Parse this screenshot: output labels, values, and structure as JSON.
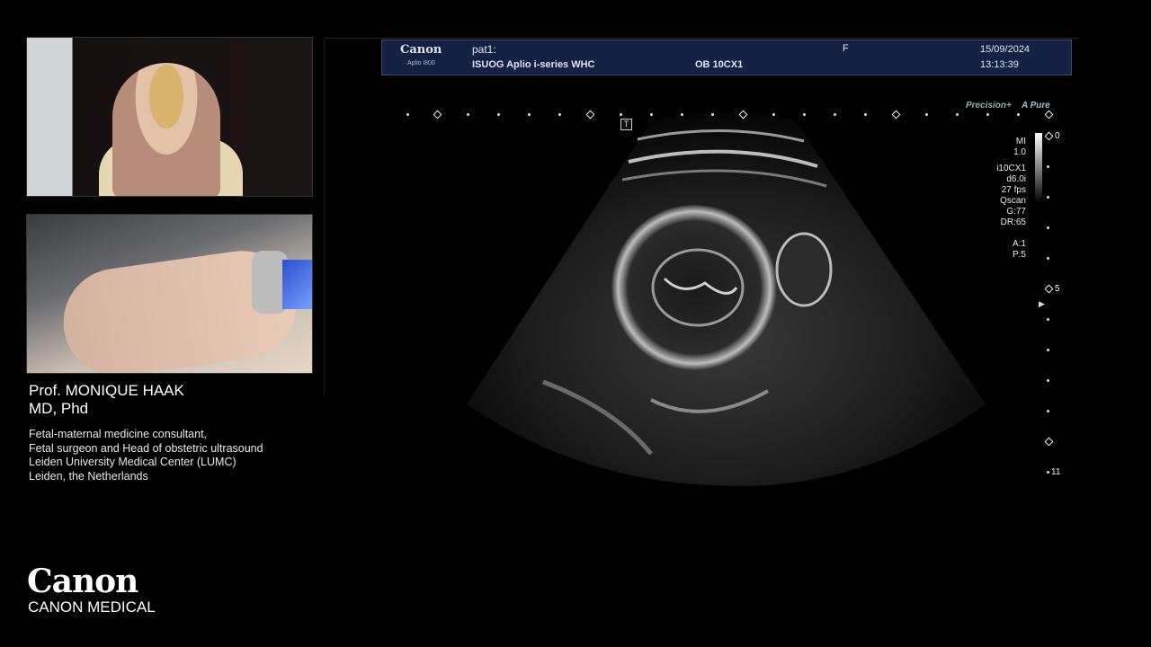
{
  "presenter": {
    "name": "Prof. MONIQUE HAAK",
    "credentials": "MD, Phd",
    "roles": [
      "Fetal-maternal medicine consultant,",
      "Fetal surgeon and Head of obstetric ultrasound",
      "Leiden University Medical Center (LUMC)",
      "Leiden, the Netherlands"
    ]
  },
  "branding": {
    "logo": "Canon",
    "subtitle": "CANON MEDICAL"
  },
  "ultrasound": {
    "header": {
      "brand": "Canon",
      "model": "Aplio i800",
      "patient": "pat1:",
      "institution": "ISUOG Aplio i-series WHC",
      "preset": "OB 10CX1",
      "sex": "F",
      "date": "15/09/2024",
      "time": "13:13:39"
    },
    "badges": {
      "precision": "Precision+",
      "apure": "A Pure"
    },
    "t_marker": "T",
    "params": [
      "MI",
      "1.0",
      "",
      "i10CX1",
      "d6.0i",
      "27 fps",
      "Qscan",
      "G:77",
      "DR:65",
      "",
      "A:1",
      "P:5"
    ],
    "depth_scale": {
      "labels": [
        "0",
        "5",
        "11"
      ]
    }
  },
  "colors": {
    "background": "#000000",
    "header_bg": "#152142"
  }
}
